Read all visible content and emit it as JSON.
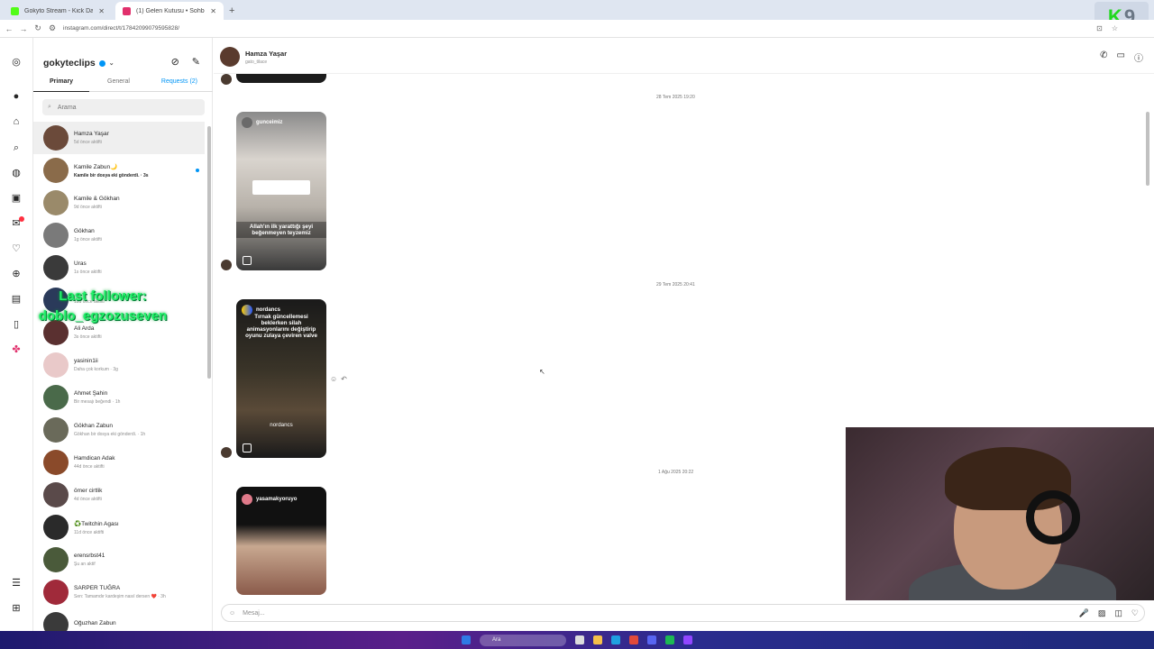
{
  "browser": {
    "tabs": [
      {
        "label": "Gokyto Stream - Kick Dashboard",
        "favicon_color": "#53fc18"
      },
      {
        "label": "(1) Gelen Kutusu • Sohbetler",
        "favicon_color": "#e1306c"
      }
    ],
    "url": "instagram.com/direct/t/17842099079595828/"
  },
  "inbox": {
    "username": "gokyteclips",
    "tabs": {
      "primary": "Primary",
      "general": "General",
      "requests": "Requests (2)"
    },
    "search_placeholder": "Arama",
    "conversations": [
      {
        "name": "Hamza Yaşar",
        "sub": "5d önce aktifti",
        "selected": true,
        "color": "#6b4a3a"
      },
      {
        "name": "Kamile Zabun🌙",
        "sub": "Kamile bir dosya eki gönderdi. · 3s",
        "unread": true,
        "color": "#8a6b4a"
      },
      {
        "name": "Kamile & Gökhan",
        "sub": "9d önce aktifti",
        "color": "#9a8a6a"
      },
      {
        "name": "Gökhan",
        "sub": "1g önce aktifti",
        "color": "#7a7a7a"
      },
      {
        "name": "Uras",
        "sub": "1s önce aktifti",
        "color": "#3a3a3a"
      },
      {
        "name": "",
        "sub": "18d önce aktifti",
        "color": "#2a3a5a"
      },
      {
        "name": "Ali Arda",
        "sub": "3s önce aktifti",
        "color": "#5a3030"
      },
      {
        "name": "yasinin1ii",
        "sub": "Daha çok korkum · 3g",
        "color": "#e9c9c9"
      },
      {
        "name": "Ahmet Şahin",
        "sub": "Bir mesajı beğendi · 1h",
        "color": "#4a6a4a"
      },
      {
        "name": "Gökhan Zabun",
        "sub": "Gökhan bir dosya eki gönderdi. · 1h",
        "color": "#6a6a5a"
      },
      {
        "name": "Hamdican Adak",
        "sub": "44d önce aktifti",
        "color": "#8a4a2a"
      },
      {
        "name": "ömer cirtlik",
        "sub": "4d önce aktifti",
        "color": "#5a4a4a"
      },
      {
        "name": "♻️Twitchin Agası",
        "sub": "11d önce aktifti",
        "color": "#2a2a2a"
      },
      {
        "name": "erensrbst41",
        "sub": "Şu an aktif",
        "color": "#4a5a3a"
      },
      {
        "name": "SARPER TUĞRA",
        "sub": "Sen: Tamamdır kardeşim nasıl dersen ❤️ · 3h",
        "color": "#a02a3a"
      },
      {
        "name": "Oğuzhan Zabun",
        "sub": "",
        "color": "#3a3a3a"
      }
    ]
  },
  "overlay": {
    "line1": "Last follower:",
    "line2": "doblo_egzozuseven"
  },
  "chat": {
    "name": "Hamza Yaşar",
    "handle": "gato_tilace",
    "dates": [
      "28 Tem 2025 19:20",
      "29 Tem 2025 20:41",
      "1 Ağu 2025 20:22"
    ],
    "reels": [
      {
        "author": "gunceimiz",
        "caption": "Allah'ın ilk yarattığı şeyi beğenmeyen teyzemiz"
      },
      {
        "author": "nordancs",
        "caption": "Tırnak güncellemesi beklerken silah animasyonlarını değiştirip oyunu zulaya çeviren valve",
        "footer": "nordancs"
      },
      {
        "author": "yasamakyoruyo",
        "caption": ""
      }
    ],
    "composer_placeholder": "Mesaj..."
  },
  "taskbar": {
    "search": "Ara"
  }
}
